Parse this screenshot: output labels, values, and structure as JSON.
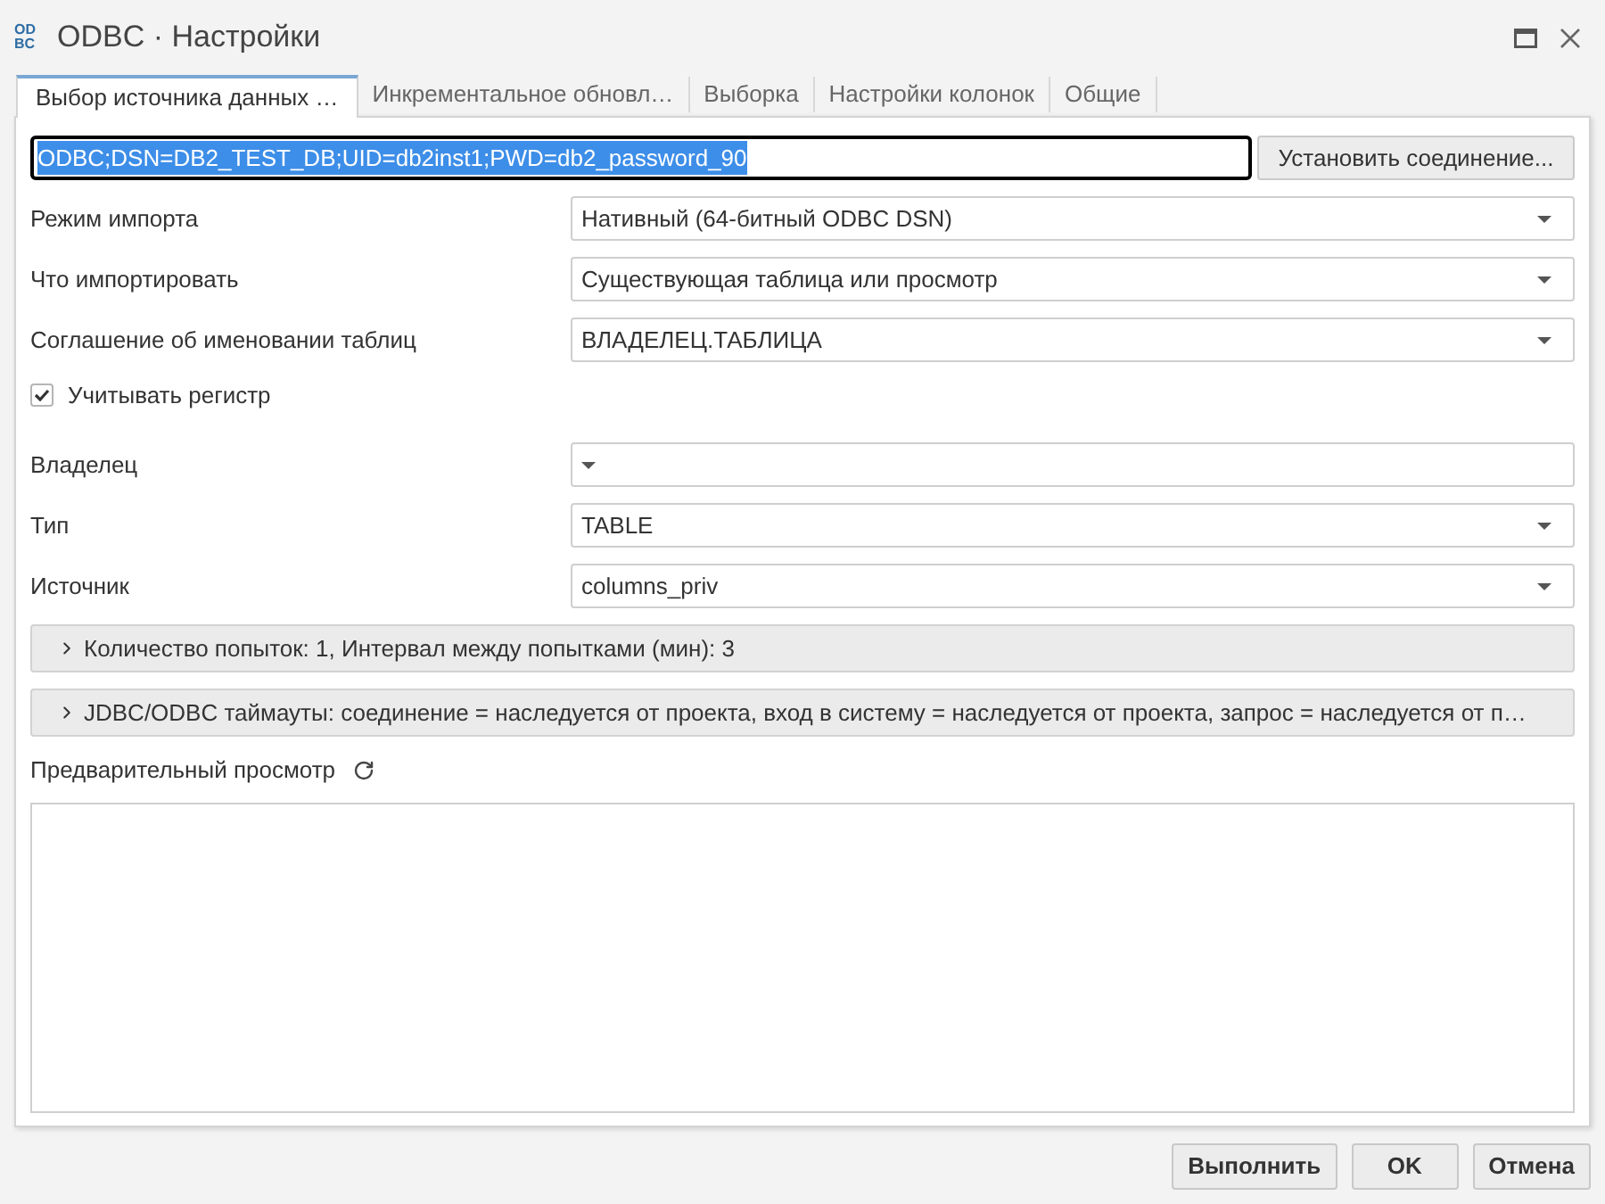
{
  "window": {
    "logo": [
      "OD",
      "BC"
    ],
    "title": "ODBC · Настройки"
  },
  "tabs": [
    {
      "label": "Выбор источника данных …",
      "selected": true
    },
    {
      "label": "Инкрементальное обновл…",
      "selected": false
    },
    {
      "label": "Выборка",
      "selected": false
    },
    {
      "label": "Настройки колонок",
      "selected": false
    },
    {
      "label": "Общие",
      "selected": false
    }
  ],
  "connection": {
    "value": "ODBC;DSN=DB2_TEST_DB;UID=db2inst1;PWD=db2_password_90",
    "text_selected": true,
    "button": "Установить соединение..."
  },
  "fields": [
    {
      "kind": "select",
      "label": "Режим импорта",
      "value": "Нативный (64-битный ODBC DSN)"
    },
    {
      "kind": "select",
      "label": "Что импортировать",
      "value": "Существующая таблица или просмотр"
    },
    {
      "kind": "select",
      "label": "Соглашение об именовании таблиц",
      "value": "ВЛАДЕЛЕЦ.ТАБЛИЦА"
    },
    {
      "kind": "checkbox",
      "label": "Учитывать регистр",
      "checked": true
    },
    {
      "kind": "select",
      "label": "Владелец"
    },
    {
      "kind": "select",
      "label": "Тип",
      "value": "TABLE"
    },
    {
      "kind": "select",
      "label": "Источник",
      "value": "columns_priv"
    }
  ],
  "sections": [
    {
      "label": "Количество попыток: 1, Интервал между попытками (мин): 3",
      "expanded": false
    },
    {
      "label": "JDBC/ODBC таймауты: соединение = наследуется от проекта, вход в систему = наследуется от проекта, запрос = наследуется от п…",
      "expanded": false
    }
  ],
  "preview": {
    "label": "Предварительный просмотр"
  },
  "buttons": [
    {
      "label": "Выполнить"
    },
    {
      "label": "OK"
    },
    {
      "label": "Отмена"
    }
  ]
}
